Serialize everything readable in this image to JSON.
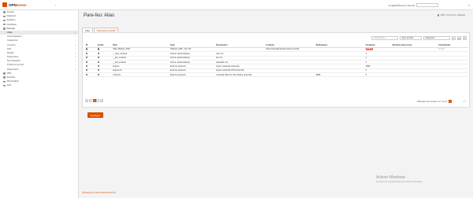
{
  "app": {
    "brand": "OPN",
    "brand2": "sense",
    "user_host": "root@OPNsense.internal",
    "collapse_icon": "chevron-left"
  },
  "sidebar": {
    "items": [
      {
        "label": "Accueil",
        "level": 0,
        "icon": "home"
      },
      {
        "label": "Rapports",
        "level": 0,
        "icon": "chart"
      },
      {
        "label": "Système",
        "level": 0,
        "icon": "computer"
      },
      {
        "label": "Interfaces",
        "level": 0,
        "icon": "network"
      },
      {
        "label": "Pare-feu",
        "level": 0,
        "icon": "fire",
        "open": true
      },
      {
        "label": "Alias",
        "level": 1,
        "active": true
      },
      {
        "label": "Automatisation",
        "level": 1
      },
      {
        "label": "Catégories",
        "level": 1
      },
      {
        "label": "Groupes",
        "level": 1
      },
      {
        "label": "NAT",
        "level": 1
      },
      {
        "label": "Règles",
        "level": 1
      },
      {
        "label": "Paramètres",
        "level": 1
      },
      {
        "label": "Normalisation",
        "level": 1
      },
      {
        "label": "Profils de journal",
        "level": 1
      },
      {
        "label": "Diagnostics",
        "level": 1
      },
      {
        "label": "VPN",
        "level": 0,
        "icon": "lock"
      },
      {
        "label": "Services",
        "level": 0,
        "icon": "gear"
      },
      {
        "label": "Alimentation",
        "level": 0,
        "icon": "power"
      },
      {
        "label": "Aide",
        "level": 0,
        "icon": "help"
      }
    ]
  },
  "page": {
    "title": "Pare-feu: Alias",
    "status": "APN / 172.16.0.1 / Alias/Ad",
    "tabs": [
      {
        "label": "Alias",
        "active": true
      },
      {
        "label": "Paramètres GeoIP",
        "active": false
      }
    ]
  },
  "toolbar": {
    "search_placeholder": "Rechercher",
    "type_filter": "Type de filtre",
    "categories": "catégories",
    "refresh_icon": "refresh",
    "columns_icon": "columns",
    "rows_per_page": "10"
  },
  "table": {
    "headers": [
      "",
      "Activé",
      "Nom",
      "Type",
      "Description",
      "Contenu",
      "Statistiques",
      "Compteur",
      "Dernière mise à jour",
      "Commandes"
    ],
    "rows": [
      {
        "name": "Alias_Blaster_IP46",
        "type": "Table(s) (URL, Geo IP)",
        "description": "",
        "content": "https://raw.githubusercontent.com/bl...",
        "stats": "",
        "count": "68958",
        "count_highlight": true,
        "updated": "",
        "has_cmds": true
      },
      {
        "name": "__wan_network",
        "type": "Interne (automatique)",
        "description": "wan net",
        "content": "",
        "stats": "",
        "count": "1",
        "count_highlight": false,
        "updated": "",
        "has_cmds": false
      },
      {
        "name": "__lan_network",
        "type": "Interne (automatique)",
        "description": "lan net",
        "content": "",
        "stats": "",
        "count": "1",
        "count_highlight": false,
        "updated": "",
        "has_cmds": false
      },
      {
        "name": "__lo0_network",
        "type": "Interne (automatique)",
        "description": "loopback net",
        "content": "",
        "stats": "",
        "count": "1",
        "count_highlight": false,
        "updated": "",
        "has_cmds": false
      },
      {
        "name": "bogons",
        "type": "Externe (avancé)",
        "description": "bogon networks (internal)",
        "content": "",
        "stats": "",
        "count": "1895",
        "count_highlight": false,
        "updated": "",
        "has_cmds": false
      },
      {
        "name": "bogonsv6",
        "type": "Externe (avancé)",
        "description": "bogon networks IPv6 (internal)",
        "content": "",
        "stats": "",
        "count": "0",
        "count_highlight": false,
        "updated": "",
        "has_cmds": false
      },
      {
        "name": "virusprot",
        "type": "Externe (avancé)",
        "description": "overload table for rate limiting (internal)",
        "content": "",
        "stats": "3898",
        "count": "0",
        "count_highlight": false,
        "updated": "",
        "has_cmds": false
      }
    ]
  },
  "pager": {
    "pages": [
      "«",
      "‹",
      "1",
      "›",
      "»"
    ],
    "current": "1",
    "info": "Affichage des entrées 1 à 7 sur 8",
    "rows": "7"
  },
  "apply_button": "Appliquer",
  "footer": "OPNsense (c) 2014-2025 Deciso B.V.",
  "watermark": {
    "line1": "Activer Windows",
    "line2": "Accédez aux paramètres pour activer Windows."
  },
  "colors": {
    "accent": "#d94f00",
    "counter_highlight": "#e65c4f",
    "status_ok": "#4caf50"
  }
}
